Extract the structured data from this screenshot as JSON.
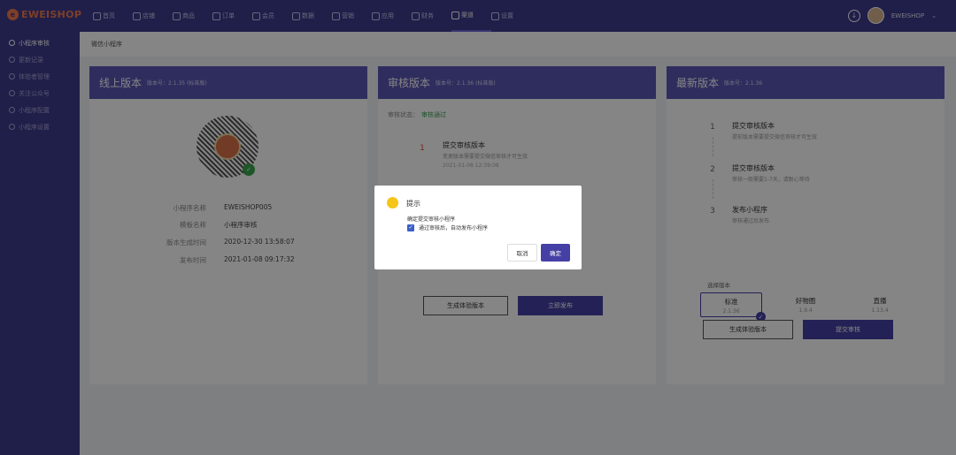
{
  "app": {
    "logo_text": "EWEISHOP",
    "user_name": "EWEISHOP"
  },
  "nav": [
    {
      "label": "首页"
    },
    {
      "label": "店铺"
    },
    {
      "label": "商品"
    },
    {
      "label": "订单"
    },
    {
      "label": "会员"
    },
    {
      "label": "数据"
    },
    {
      "label": "营销"
    },
    {
      "label": "应用"
    },
    {
      "label": "财务"
    },
    {
      "label": "渠道",
      "active": true
    },
    {
      "label": "设置"
    }
  ],
  "sidebar": [
    {
      "label": "小程序审核",
      "active": true
    },
    {
      "label": "更新记录"
    },
    {
      "label": "体验者管理"
    },
    {
      "label": "关注公众号"
    },
    {
      "label": "小程序配置"
    },
    {
      "label": "小程序设置"
    }
  ],
  "breadcrumb": "微信小程序",
  "online": {
    "title": "线上版本",
    "version": "版本号：2.1.35 (标准版)",
    "rows": [
      {
        "label": "小程序名称",
        "value": "EWEISHOP005"
      },
      {
        "label": "模板名称",
        "value": "小程序审核"
      },
      {
        "label": "版本生成时间",
        "value": "2020-12-30 13:58:07"
      },
      {
        "label": "发布时间",
        "value": "2021-01-08 09:17:32"
      }
    ]
  },
  "review": {
    "title": "审核版本",
    "version": "版本号：2.1.36 (标准版)",
    "status_label": "审核状态：",
    "status_value": "审核通过",
    "step1_num": "1",
    "step1_title": "提交审核版本",
    "step1_desc": "变更版本需要提交微信审核才可生效",
    "step1_time": "2021-01-08 12:39:08",
    "btn_trial": "生成体验版本",
    "btn_publish": "立即发布"
  },
  "latest": {
    "title": "最新版本",
    "version": "版本号：2.1.36",
    "steps": [
      {
        "num": "1",
        "title": "提交审核版本",
        "desc": "提前版本需要提交微信审核才可生效"
      },
      {
        "num": "2",
        "title": "提交审核版本",
        "desc": "审核一般需要1-7天，请耐心等待"
      },
      {
        "num": "3",
        "title": "发布小程序",
        "desc": "审核通过后发布"
      }
    ],
    "select_label": "选择版本",
    "options": [
      {
        "name": "标准",
        "ver": "2.1.36",
        "selected": true
      },
      {
        "name": "好物圈",
        "ver": "1.9.4"
      },
      {
        "name": "直播",
        "ver": "1.13.4"
      }
    ],
    "btn_trial": "生成体验版本",
    "btn_submit": "提交审核"
  },
  "modal": {
    "title": "提示",
    "text": "确定提交审核小程序",
    "checkbox_label": "通过审核后，自动发布小程序",
    "checked": true,
    "cancel": "取消",
    "ok": "确定"
  },
  "colors": {
    "topbar": "#3f3c8e",
    "card_header": "#5a57b5",
    "primary": "#4540a5",
    "success": "#37a055",
    "warning": "#f5c518"
  }
}
